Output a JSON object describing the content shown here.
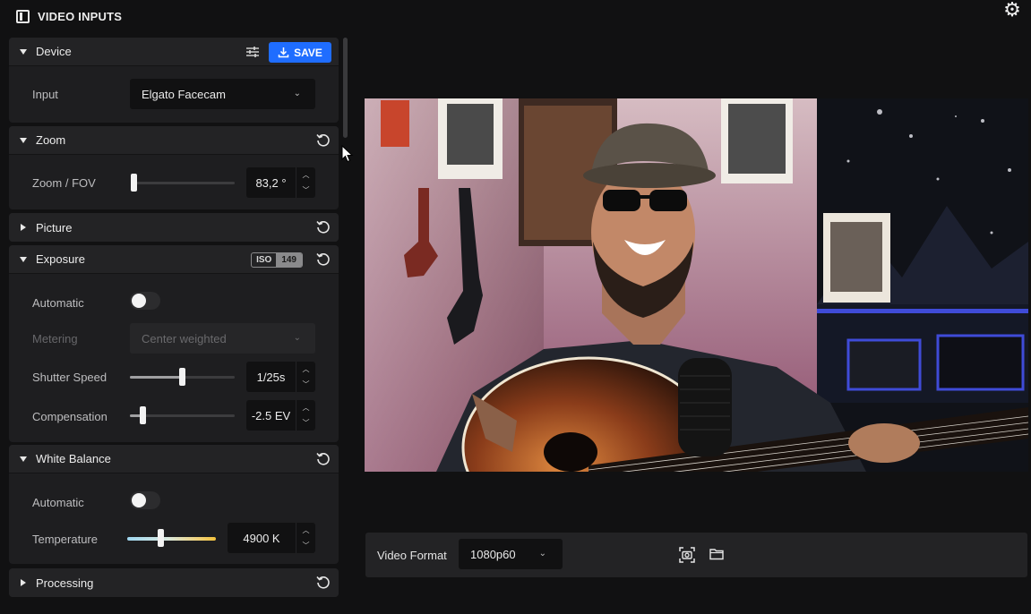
{
  "app": {
    "title": "VIDEO INPUTS"
  },
  "device": {
    "title": "Device",
    "save_label": "SAVE",
    "input_label": "Input",
    "input_value": "Elgato Facecam"
  },
  "zoom": {
    "title": "Zoom",
    "fov_label": "Zoom / FOV",
    "fov_value": "83,2 °",
    "slider_fraction": 0.0
  },
  "picture": {
    "title": "Picture"
  },
  "exposure": {
    "title": "Exposure",
    "iso_key": "ISO",
    "iso_value": "149",
    "automatic_label": "Automatic",
    "automatic_on": false,
    "metering_label": "Metering",
    "metering_value": "Center weighted",
    "shutter_label": "Shutter Speed",
    "shutter_value": "1/25s",
    "shutter_fraction": 0.5,
    "compensation_label": "Compensation",
    "compensation_value": "-2.5 EV",
    "compensation_fraction": 0.1
  },
  "white_balance": {
    "title": "White Balance",
    "automatic_label": "Automatic",
    "automatic_on": false,
    "temperature_label": "Temperature",
    "temperature_value": "4900 K",
    "temperature_fraction": 0.37
  },
  "processing": {
    "title": "Processing"
  },
  "bottom": {
    "video_format_label": "Video Format",
    "video_format_value": "1080p60"
  },
  "colors": {
    "accent": "#1f6dff",
    "panel": "#1e1e20",
    "background": "#111112"
  }
}
